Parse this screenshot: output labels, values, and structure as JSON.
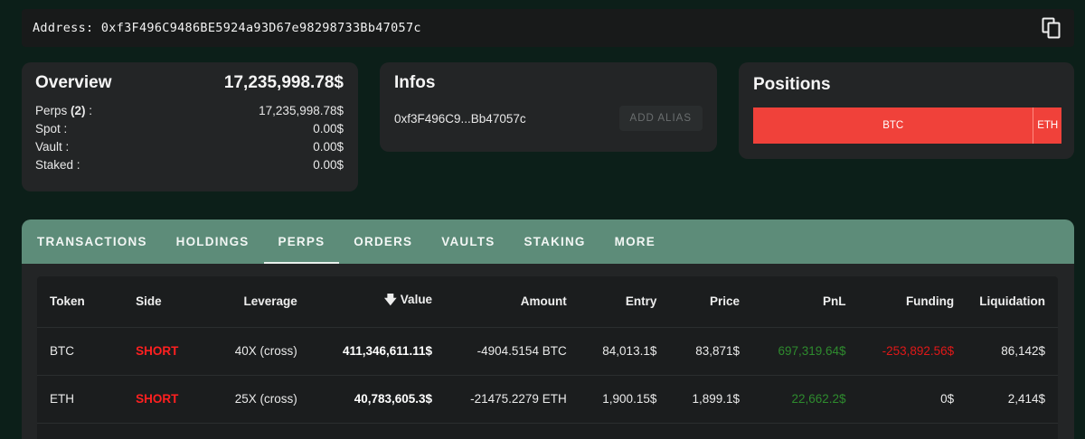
{
  "address_bar": {
    "label": "Address: 0xf3F496C9486BE5924a93D67e98298733Bb47057c",
    "copy_icon": "copy-icon"
  },
  "overview": {
    "title": "Overview",
    "total": "17,235,998.78$",
    "rows": [
      {
        "label": "Perps ",
        "count": "(2)",
        "suffix": " :",
        "value": "17,235,998.78$"
      },
      {
        "label": "Spot :",
        "value": "0.00$"
      },
      {
        "label": "Vault :",
        "value": "0.00$"
      },
      {
        "label": "Staked :",
        "value": "0.00$"
      }
    ]
  },
  "infos": {
    "title": "Infos",
    "address_short": "0xf3F496C9...Bb47057c",
    "alias_button": "ADD ALIAS"
  },
  "positions": {
    "title": "Positions",
    "segments": [
      {
        "label": "BTC",
        "share": 0.91,
        "color": "#f0413a"
      },
      {
        "label": "ETH",
        "share": 0.09,
        "color": "#f0413a"
      }
    ]
  },
  "tabs": [
    "TRANSACTIONS",
    "HOLDINGS",
    "PERPS",
    "ORDERS",
    "VAULTS",
    "STAKING",
    "MORE"
  ],
  "active_tab": "PERPS",
  "table": {
    "sort_icon": "arrow-down-icon",
    "headers": [
      "Token",
      "Side",
      "Leverage",
      "Value",
      "Amount",
      "Entry",
      "Price",
      "PnL",
      "Funding",
      "Liquidation"
    ],
    "rows": [
      {
        "token": "BTC",
        "side": "SHORT",
        "leverage": "40X (cross)",
        "value": "411,346,611.11$",
        "amount": "-4904.5154 BTC",
        "entry": "84,013.1$",
        "price": "83,871$",
        "pnl": "697,319.64$",
        "funding": "-253,892.56$",
        "liquidation": "86,142$"
      },
      {
        "token": "ETH",
        "side": "SHORT",
        "leverage": "25X (cross)",
        "value": "40,783,605.3$",
        "amount": "-21475.2279 ETH",
        "entry": "1,900.15$",
        "price": "1,899.1$",
        "pnl": "22,662.2$",
        "funding": "0$",
        "liquidation": "2,414$"
      }
    ]
  },
  "colors": {
    "background": "#0c1f19",
    "tab_bar": "#5d8c79",
    "short": "#ff2020",
    "positive": "#2e8b2e",
    "negative": "#e01818",
    "position_bar": "#f0413a"
  }
}
